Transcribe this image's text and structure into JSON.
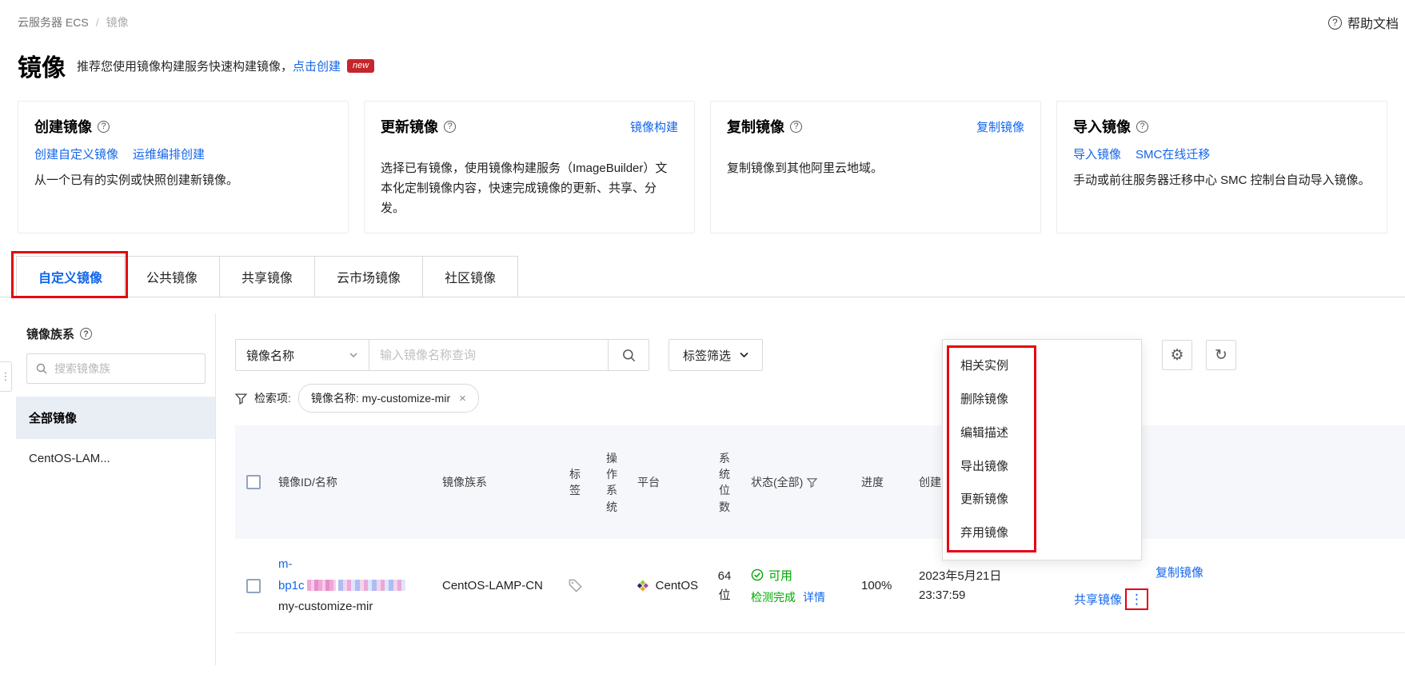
{
  "colors": {
    "link": "#1366ec",
    "annotation": "#e60012",
    "success": "#00a700",
    "badge_bg": "#c5262c"
  },
  "icons": {
    "help": "?",
    "gear": "⚙",
    "refresh": "↻",
    "more_vertical": "⋮",
    "close": "×"
  },
  "breadcrumb": {
    "root": "云服务器 ECS",
    "separator": "/",
    "current": "镜像",
    "help_doc": "帮助文档"
  },
  "header": {
    "title": "镜像",
    "subtitle": "推荐您使用镜像构建服务快速构建镜像，",
    "create_link": "点击创建",
    "new_badge": "new"
  },
  "cards": [
    {
      "title": "创建镜像",
      "link1": "创建自定义镜像",
      "link2": "运维编排创建",
      "desc": "从一个已有的实例或快照创建新镜像。"
    },
    {
      "title": "更新镜像",
      "corner_link": "镜像构建",
      "desc": "选择已有镜像，使用镜像构建服务（ImageBuilder）文本化定制镜像内容，快速完成镜像的更新、共享、分发。"
    },
    {
      "title": "复制镜像",
      "corner_link": "复制镜像",
      "desc": "复制镜像到其他阿里云地域。"
    },
    {
      "title": "导入镜像",
      "link1": "导入镜像",
      "link2": "SMC在线迁移",
      "desc": "手动或前往服务器迁移中心 SMC 控制台自动导入镜像。"
    }
  ],
  "tabs": [
    {
      "label": "自定义镜像"
    },
    {
      "label": "公共镜像"
    },
    {
      "label": "共享镜像"
    },
    {
      "label": "云市场镜像"
    },
    {
      "label": "社区镜像"
    }
  ],
  "sidebar": {
    "title": "镜像族系",
    "search_placeholder": "搜索镜像族",
    "items": [
      {
        "label": "全部镜像"
      },
      {
        "label": "CentOS-LAM..."
      }
    ]
  },
  "filters": {
    "field_selector": "镜像名称",
    "search_placeholder": "输入镜像名称查询",
    "tag_filter_label": "标签筛选",
    "applied_label": "检索项:",
    "applied_tag": "镜像名称: my-customize-mir"
  },
  "table": {
    "headers": {
      "id_name": "镜像ID/名称",
      "family": "镜像族系",
      "tags": "标签",
      "os": "操作系统",
      "platform": "平台",
      "bits": "系统位数",
      "status": "状态(全部)",
      "progress": "进度",
      "created": "创建时间"
    },
    "row": {
      "id_line1": "m-",
      "id_prefix": "bp1c",
      "name": "my-customize-mir",
      "family": "CentOS-LAMP-CN",
      "platform": "CentOS",
      "bits_line1": "64",
      "bits_line2": "位",
      "status": "可用",
      "status_detail": "检测完成",
      "detail_link": "详情",
      "progress": "100%",
      "created_date": "2023年5月21日",
      "created_time": "23:37:59",
      "action_copy": "复制镜像",
      "action_share": "共享镜像"
    }
  },
  "context_menu": {
    "items": [
      {
        "label": "相关实例"
      },
      {
        "label": "删除镜像"
      },
      {
        "label": "编辑描述"
      },
      {
        "label": "导出镜像"
      },
      {
        "label": "更新镜像"
      },
      {
        "label": "弃用镜像"
      }
    ]
  }
}
